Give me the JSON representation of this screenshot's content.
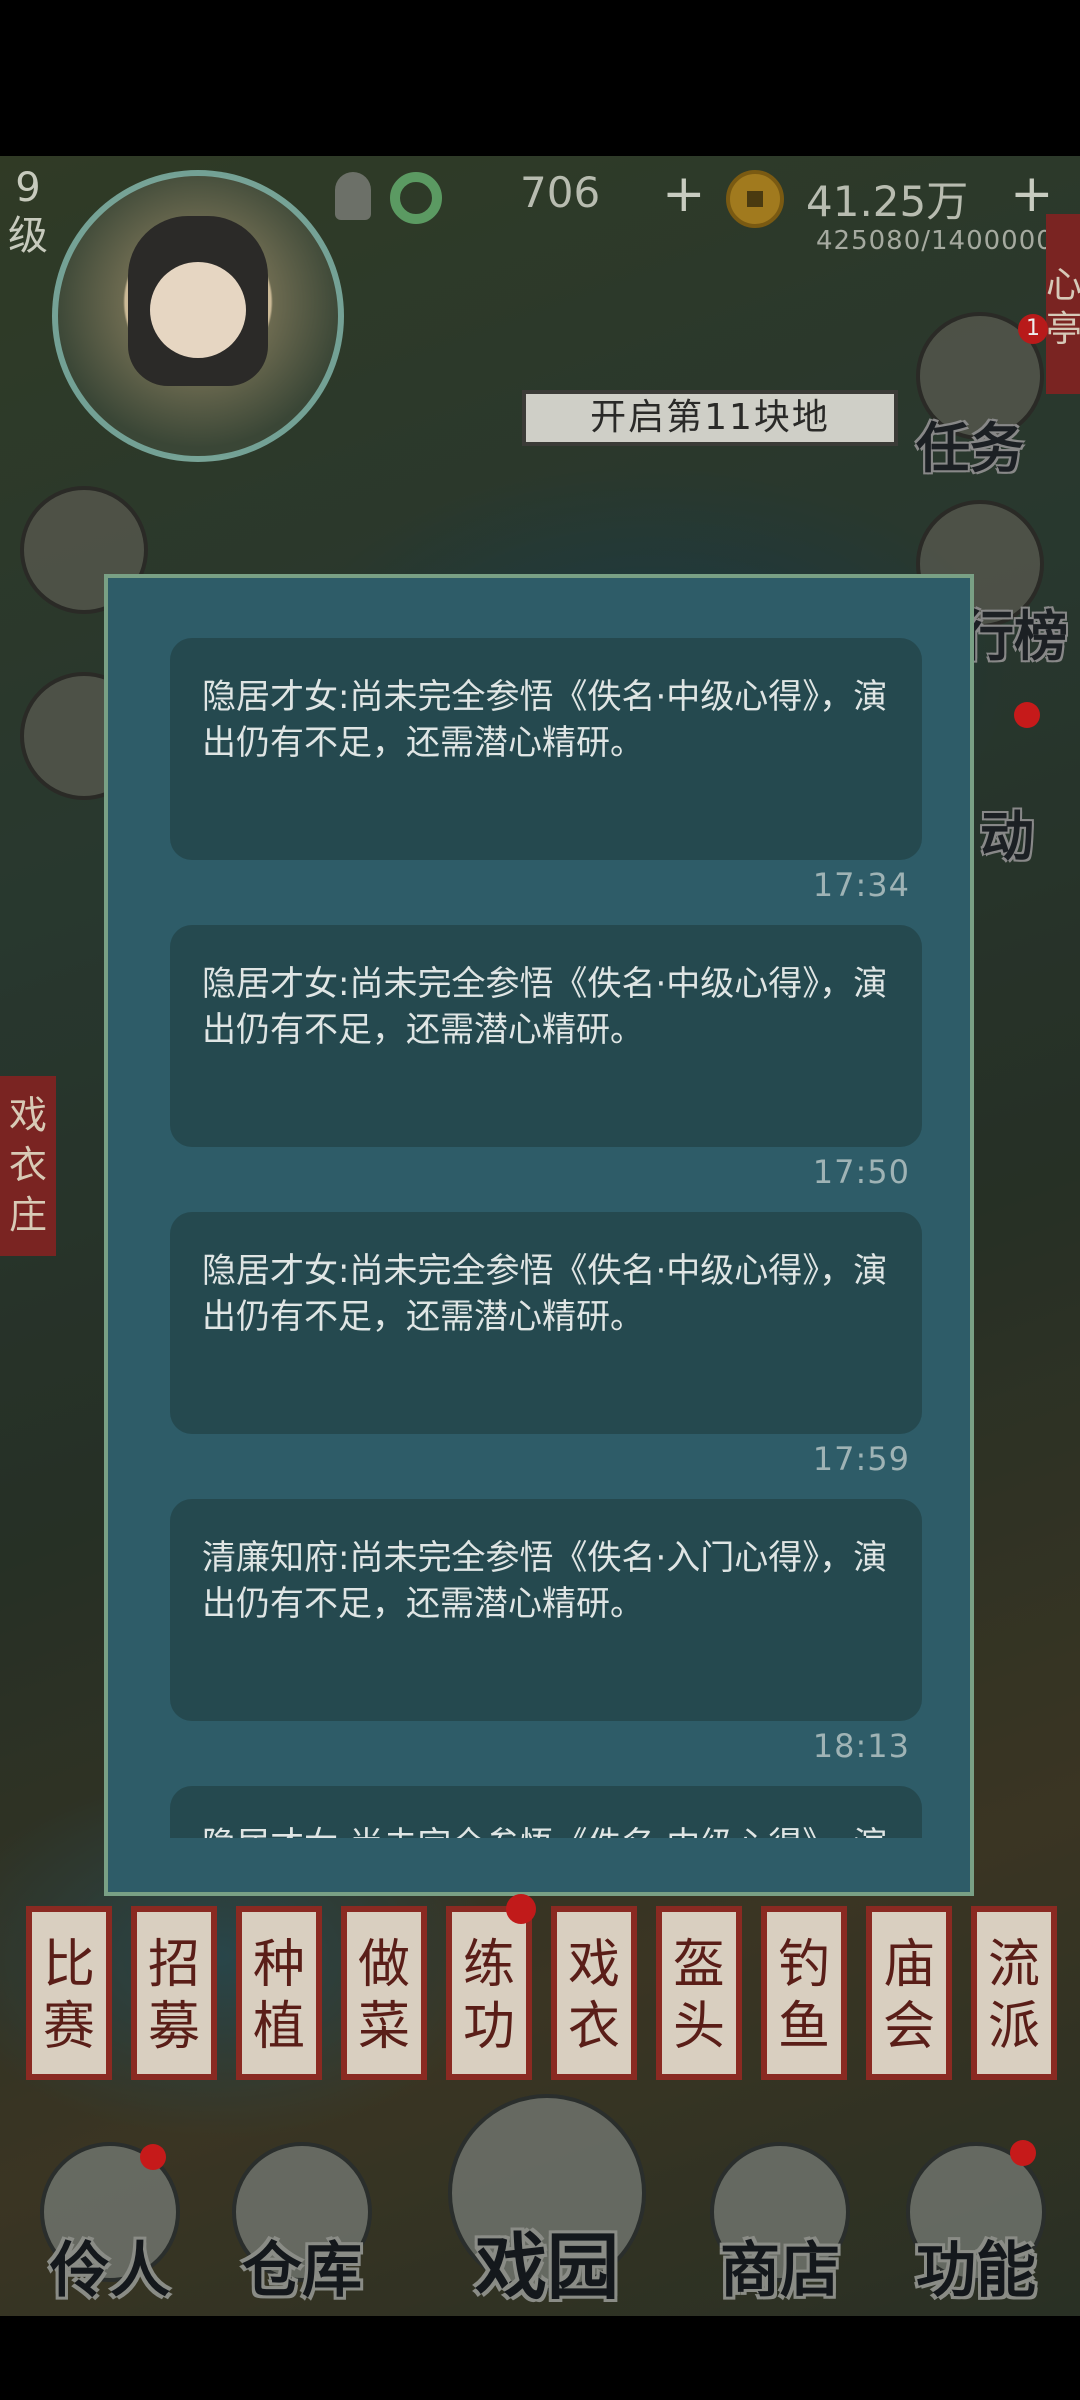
{
  "hud": {
    "level_label": "9\n级",
    "jade_count": "706",
    "jade_plus": "+",
    "money": "41.25万",
    "money_plus": "+",
    "exp_progress": "425080/1400000",
    "side_tag_top": "心\n亭",
    "open_land_label": "开启第11块地"
  },
  "side_menu": {
    "task_label": "任务",
    "task_badge": "1",
    "rank_label": "行榜",
    "activity_label": "动"
  },
  "map_tags": {
    "costume_shop": "戏\n衣\n庄"
  },
  "messages": [
    {
      "text": "隐居才女:尚未完全参悟《佚名·中级心得》，演出仍有不足，还需潜心精研。",
      "time": "17:34"
    },
    {
      "text": "隐居才女:尚未完全参悟《佚名·中级心得》，演出仍有不足，还需潜心精研。",
      "time": "17:50"
    },
    {
      "text": "隐居才女:尚未完全参悟《佚名·中级心得》，演出仍有不足，还需潜心精研。",
      "time": "17:59"
    },
    {
      "text": "清廉知府:尚未完全参悟《佚名·入门心得》，演出仍有不足，还需潜心精研。",
      "time": "18:13"
    },
    {
      "text": "隐居才女:尚未完全参悟《佚名·中级心得》，演出仍有不足，还需潜心精研。",
      "time": ""
    }
  ],
  "actions": [
    "比赛",
    "招募",
    "种植",
    "做菜",
    "练功",
    "戏衣",
    "盔头",
    "钓鱼",
    "庙会",
    "流派"
  ],
  "nav": {
    "actors": "伶人",
    "warehouse": "仓库",
    "theater": "戏园",
    "shop": "商店",
    "functions": "功能"
  }
}
